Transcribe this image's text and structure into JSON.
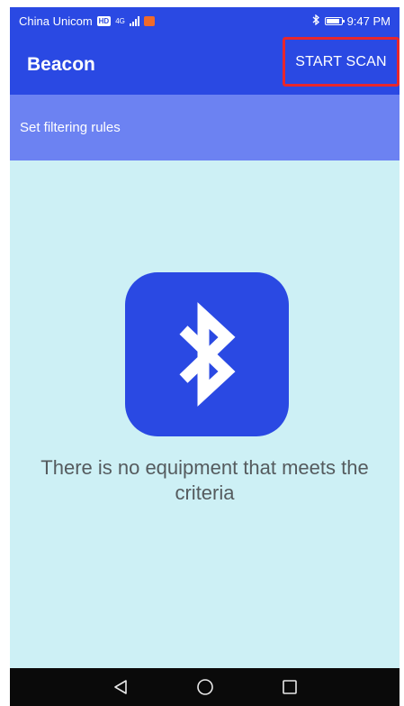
{
  "status_bar": {
    "carrier": "China Unicom",
    "hd_badge": "HD",
    "network": "4G",
    "time": "9:47 PM"
  },
  "app_bar": {
    "title": "Beacon",
    "start_scan_label": "START SCAN"
  },
  "filter_bar": {
    "label": "Set filtering rules"
  },
  "content": {
    "empty_message": "There is no equipment that meets the criteria",
    "icon": "bluetooth-icon"
  },
  "nav_bar": {
    "icons": [
      "back-icon",
      "home-icon",
      "recents-icon"
    ]
  },
  "colors": {
    "primary": "#2a49e3",
    "filter_bar": "#6c82f2",
    "background": "#cdf0f5",
    "highlight": "#e8262b"
  }
}
